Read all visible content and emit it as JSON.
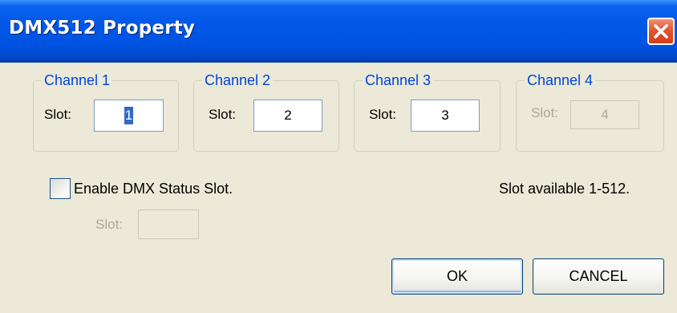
{
  "window": {
    "title": "DMX512 Property"
  },
  "channels": [
    {
      "legend": "Channel 1",
      "slot_label": "Slot:",
      "slot_value": "1",
      "enabled": true,
      "selected": true
    },
    {
      "legend": "Channel 2",
      "slot_label": "Slot:",
      "slot_value": "2",
      "enabled": true,
      "selected": false
    },
    {
      "legend": "Channel 3",
      "slot_label": "Slot:",
      "slot_value": "3",
      "enabled": true,
      "selected": false
    },
    {
      "legend": "Channel 4",
      "slot_label": "Slot:",
      "slot_value": "4",
      "enabled": false,
      "selected": false
    }
  ],
  "status_slot": {
    "checkbox_label": "Enable DMX Status Slot.",
    "checked": false,
    "slot_label": "Slot:",
    "slot_value": ""
  },
  "info": {
    "slot_range": "Slot available 1-512."
  },
  "buttons": {
    "ok_label": "OK",
    "cancel_label": "CANCEL"
  },
  "colors": {
    "title_bar": "#0054e3",
    "close_button": "#e2552f",
    "dialog_bg": "#ece9d8",
    "group_legend": "#0046d5",
    "disabled_text": "#aca899",
    "selection": "#316ac5"
  },
  "icons": {
    "close": "close-x-icon"
  }
}
